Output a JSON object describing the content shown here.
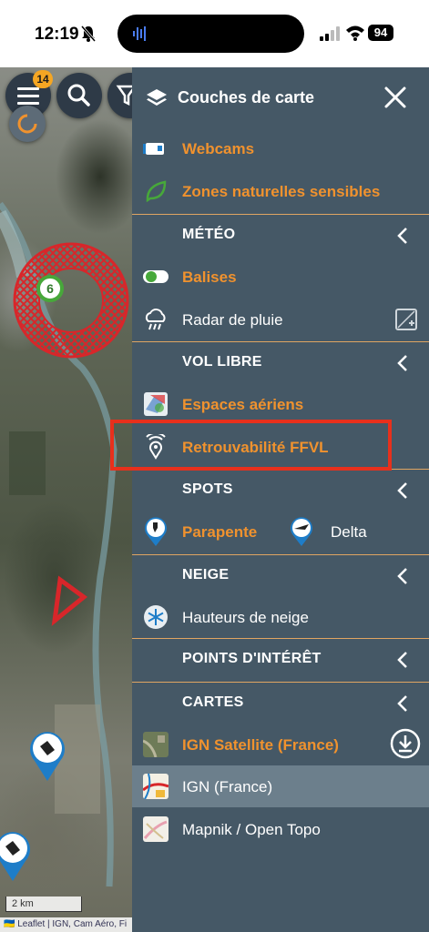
{
  "status_bar": {
    "time": "12:19",
    "battery": "94"
  },
  "map": {
    "notification_count": "14",
    "cluster_count": "6",
    "scale_label": "2 km",
    "attribution": "🇺🇦 Leaflet | IGN, Cam Aéro, Fi"
  },
  "panel": {
    "title": "Couches de carte",
    "top_items": [
      {
        "label": "Webcams",
        "icon": "webcam-icon"
      },
      {
        "label": "Zones naturelles sensibles",
        "icon": "leaf-icon"
      }
    ],
    "sections": {
      "meteo": {
        "title": "MÉTÉO",
        "items": [
          {
            "label": "Balises",
            "icon": "beacon-toggle-icon"
          },
          {
            "label": "Radar de pluie",
            "icon": "rain-cloud-icon"
          }
        ]
      },
      "vol_libre": {
        "title": "VOL LIBRE",
        "items": [
          {
            "label": "Espaces aériens",
            "icon": "airspace-icon"
          },
          {
            "label": "Retrouvabilité FFVL",
            "icon": "location-signal-icon"
          }
        ]
      },
      "spots": {
        "title": "SPOTS",
        "items": [
          {
            "label": "Parapente",
            "icon": "paraglider-pin-icon"
          },
          {
            "label": "Delta",
            "icon": "hangglider-pin-icon"
          }
        ]
      },
      "neige": {
        "title": "NEIGE",
        "items": [
          {
            "label": "Hauteurs de neige",
            "icon": "snowflake-icon"
          }
        ]
      },
      "poi": {
        "title": "POINTS D'INTÉRÊT"
      },
      "cartes": {
        "title": "CARTES",
        "items": [
          {
            "label": "IGN Satellite (France)",
            "icon": "satellite-thumb-icon"
          },
          {
            "label": "IGN (France)",
            "icon": "ign-map-thumb-icon"
          },
          {
            "label": "Mapnik / Open Topo",
            "icon": "topo-map-thumb-icon"
          }
        ]
      }
    }
  },
  "colors": {
    "panel_bg": "#455866",
    "accent_orange": "#f0922e",
    "highlight_red": "#e8301c",
    "selected_row": "#6c7f8c"
  }
}
